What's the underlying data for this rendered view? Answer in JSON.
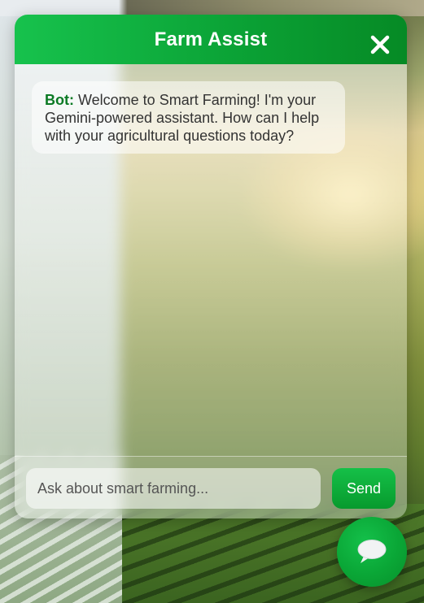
{
  "chat": {
    "title": "Farm Assist",
    "close_icon": "close-icon",
    "messages": [
      {
        "sender": "Bot:",
        "text": " Welcome to Smart Farming! I'm your Gemini-powered assistant. How can I help with your agricultural questions today?"
      }
    ],
    "input": {
      "placeholder": "Ask about smart farming...",
      "value": ""
    },
    "send_label": "Send"
  },
  "fab": {
    "icon": "chat-bubble-icon"
  },
  "colors": {
    "header": "#0ba336",
    "accent": "#0b7a24",
    "send": "#079a2d"
  }
}
